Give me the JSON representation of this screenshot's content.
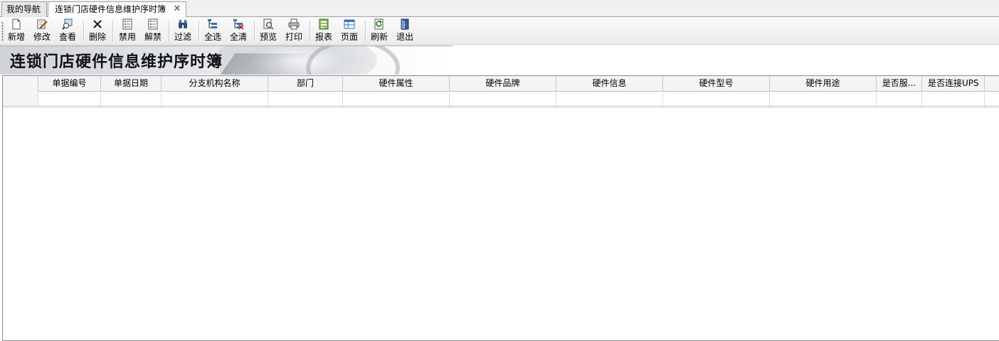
{
  "tabs": [
    {
      "label": "我的导航"
    },
    {
      "label": "连锁门店硬件信息维护序时簿",
      "close": "✕"
    }
  ],
  "toolbar": {
    "new": "新增",
    "edit": "修改",
    "view": "查看",
    "delete": "删除",
    "disable": "禁用",
    "enable": "解禁",
    "filter": "过滤",
    "select_all": "全选",
    "clear_all": "全清",
    "preview": "预览",
    "print": "打印",
    "report": "报表",
    "page": "页面",
    "refresh": "刷新",
    "exit": "退出"
  },
  "banner": {
    "title": "连锁门店硬件信息维护序时簿"
  },
  "grid": {
    "columns": [
      "单据编号",
      "单据日期",
      "分支机构名称",
      "部门",
      "硬件属性",
      "硬件品牌",
      "硬件信息",
      "硬件型号",
      "硬件用途",
      "是否服...",
      "是否连接UPS"
    ]
  },
  "colors": {
    "tab_bg": "#e7e7e7",
    "toolbar_bg": "#f2f2f2",
    "grid_header": "#f4f4f4"
  }
}
